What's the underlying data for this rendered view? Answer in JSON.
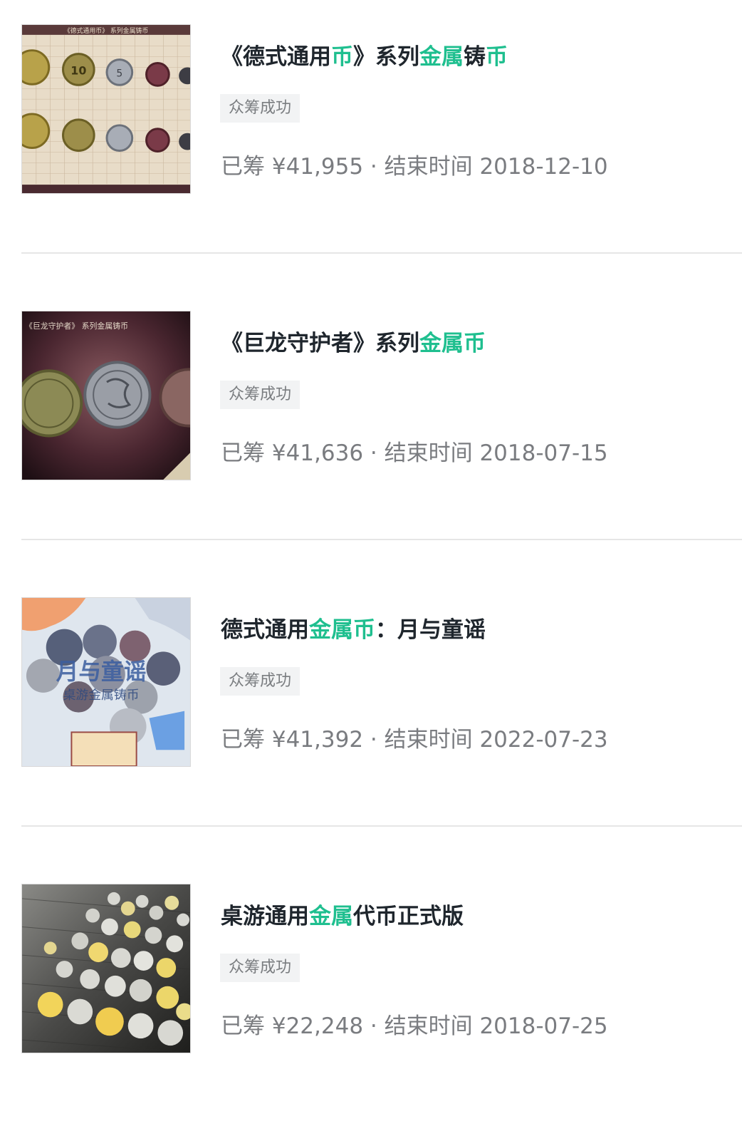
{
  "items": [
    {
      "title_parts": [
        {
          "text": "《德式通用",
          "highlight": false
        },
        {
          "text": "币",
          "highlight": true
        },
        {
          "text": "》系列",
          "highlight": false
        },
        {
          "text": "金属",
          "highlight": true
        },
        {
          "text": "铸",
          "highlight": false
        },
        {
          "text": "币",
          "highlight": true
        }
      ],
      "badge": "众筹成功",
      "meta": "已筹 ¥41,955 · 结束时间 2018-12-10",
      "image_caption": "《德式通用币》 系列金属铸币"
    },
    {
      "title_parts": [
        {
          "text": "《巨龙守护者》系列",
          "highlight": false
        },
        {
          "text": "金属币",
          "highlight": true
        }
      ],
      "badge": "众筹成功",
      "meta": "已筹 ¥41,636 · 结束时间 2018-07-15",
      "image_caption": "《巨龙守护者》 系列金属铸币"
    },
    {
      "title_parts": [
        {
          "text": "德式通用",
          "highlight": false
        },
        {
          "text": "金属币",
          "highlight": true
        },
        {
          "text": "：月与童谣",
          "highlight": false
        }
      ],
      "badge": "众筹成功",
      "meta": "已筹 ¥41,392 · 结束时间 2022-07-23",
      "image_caption": "月与童谣",
      "image_subcaption": "桌游金属铸币"
    },
    {
      "title_parts": [
        {
          "text": "桌游通用",
          "highlight": false
        },
        {
          "text": "金属",
          "highlight": true
        },
        {
          "text": "代币正式版",
          "highlight": false
        }
      ],
      "badge": "众筹成功",
      "meta": "已筹 ¥22,248 · 结束时间 2018-07-25"
    }
  ],
  "colors": {
    "highlight": "#1fbf8f",
    "title": "#1f262d",
    "meta": "#7a7c80",
    "badge_bg": "#f2f3f4",
    "badge_text": "#7a7d80",
    "divider": "#e6e6e6"
  }
}
